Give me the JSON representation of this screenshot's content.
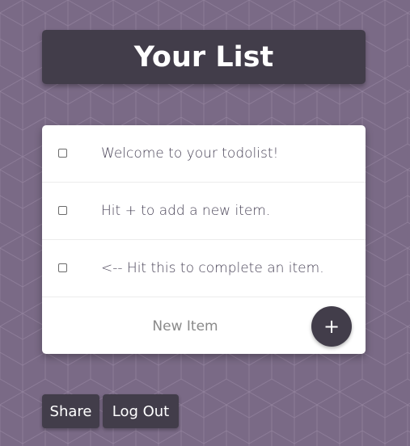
{
  "header": {
    "title": "Your List"
  },
  "todo": {
    "items": [
      {
        "label": "Welcome to your todolist!",
        "checked": false
      },
      {
        "label": "Hit + to add a new item.",
        "checked": false
      },
      {
        "label": "<-- Hit this to complete an item.",
        "checked": false
      }
    ],
    "new_item": {
      "placeholder": "New Item",
      "value": ""
    },
    "add_button_label": "+"
  },
  "footer": {
    "share_label": "Share",
    "logout_label": "Log Out"
  },
  "colors": {
    "background": "#7a6a86",
    "dark_accent": "#423d4a",
    "card": "#ffffff",
    "item_text": "#4a4458"
  }
}
